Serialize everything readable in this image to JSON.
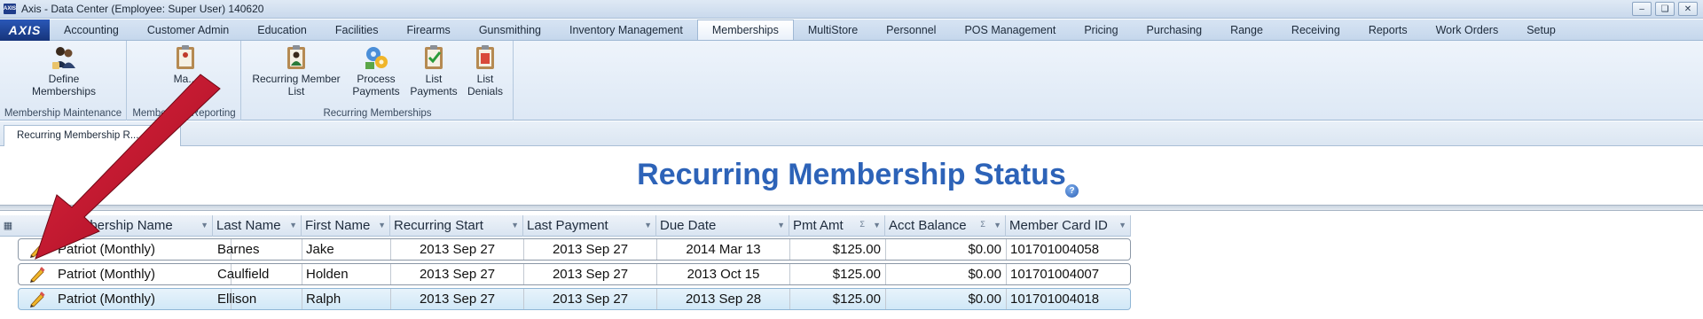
{
  "window": {
    "title": "Axis - Data Center  (Employee: Super User) 140620",
    "app_icon_text": "AXIS",
    "controls": [
      "minimize",
      "restore",
      "close"
    ]
  },
  "menu": {
    "logo": "AXIS",
    "tabs": [
      {
        "label": "Accounting"
      },
      {
        "label": "Customer Admin"
      },
      {
        "label": "Education"
      },
      {
        "label": "Facilities"
      },
      {
        "label": "Firearms"
      },
      {
        "label": "Gunsmithing"
      },
      {
        "label": "Inventory Management"
      },
      {
        "label": "Memberships",
        "active": true
      },
      {
        "label": "MultiStore"
      },
      {
        "label": "Personnel"
      },
      {
        "label": "POS Management"
      },
      {
        "label": "Pricing"
      },
      {
        "label": "Purchasing"
      },
      {
        "label": "Range"
      },
      {
        "label": "Receiving"
      },
      {
        "label": "Reports"
      },
      {
        "label": "Work Orders"
      },
      {
        "label": "Setup"
      }
    ]
  },
  "ribbon": {
    "groups": [
      {
        "label": "Membership Maintenance",
        "buttons": [
          {
            "label": "Define Memberships",
            "icon": "people-icon"
          }
        ]
      },
      {
        "label": "Membership Reporting",
        "buttons": [
          {
            "label": "Ma...",
            "icon": "clipboard-icon"
          }
        ]
      },
      {
        "label": "Recurring Memberships",
        "buttons": [
          {
            "label": "Recurring Member List",
            "icon": "member-list-icon"
          },
          {
            "label": "Process Payments",
            "icon": "process-payments-icon"
          },
          {
            "label": "List Payments",
            "icon": "check-list-icon"
          },
          {
            "label": "List Denials",
            "icon": "denials-list-icon"
          }
        ]
      }
    ]
  },
  "doc_tab": {
    "label": "Recurring Membership R..."
  },
  "page": {
    "title": "Recurring Membership Status",
    "help_glyph": "?"
  },
  "grid": {
    "columns": [
      {
        "label": "Membership Name"
      },
      {
        "label": "Last Name"
      },
      {
        "label": "First Name"
      },
      {
        "label": "Recurring Start"
      },
      {
        "label": "Last Payment"
      },
      {
        "label": "Due Date"
      },
      {
        "label": "Pmt Amt",
        "summary": true
      },
      {
        "label": "Acct Balance",
        "summary": true
      },
      {
        "label": "Member Card ID"
      }
    ],
    "rows": [
      {
        "membership": "Patriot (Monthly)",
        "last": "Barnes",
        "first": "Jake",
        "start": "2013 Sep 27",
        "last_payment": "2013 Sep 27",
        "due": "2014 Mar 13",
        "pmt": "$125.00",
        "balance": "$0.00",
        "card": "101701004058"
      },
      {
        "membership": "Patriot (Monthly)",
        "last": "Caulfield",
        "first": "Holden",
        "start": "2013 Sep 27",
        "last_payment": "2013 Sep 27",
        "due": "2013 Oct 15",
        "pmt": "$125.00",
        "balance": "$0.00",
        "card": "101701004007"
      },
      {
        "membership": "Patriot (Monthly)",
        "last": "Ellison",
        "first": "Ralph",
        "start": "2013 Sep 27",
        "last_payment": "2013 Sep 27",
        "due": "2013 Sep 28",
        "pmt": "$125.00",
        "balance": "$0.00",
        "card": "101701004018",
        "selected": true
      }
    ]
  },
  "annotation": {
    "color": "#c8102e"
  }
}
